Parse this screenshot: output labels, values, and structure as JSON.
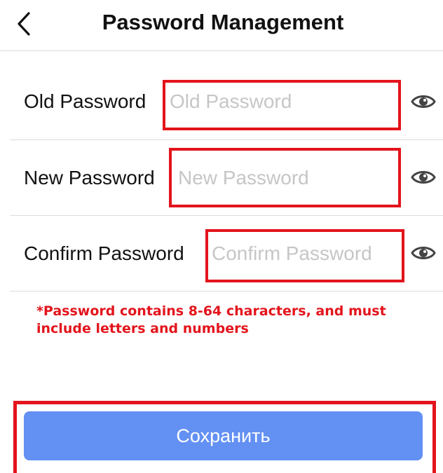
{
  "header": {
    "title": "Password Management"
  },
  "form": {
    "old_password": {
      "label": "Old Password",
      "placeholder": "Old Password",
      "value": ""
    },
    "new_password": {
      "label": "New Password",
      "placeholder": "New Password",
      "value": ""
    },
    "confirm_password": {
      "label": "Confirm Password",
      "placeholder": "Confirm Password",
      "value": ""
    }
  },
  "hint": {
    "text": "*Password contains 8-64 characters, and must include letters and numbers"
  },
  "actions": {
    "save_label": "Сохранить"
  },
  "colors": {
    "highlight": "#e3141c",
    "primary_button": "#6390f3",
    "placeholder": "#c6c6c6",
    "divider": "#dcdcdc"
  },
  "icons": {
    "back": "chevron-left-icon",
    "visibility": "eye-icon"
  }
}
